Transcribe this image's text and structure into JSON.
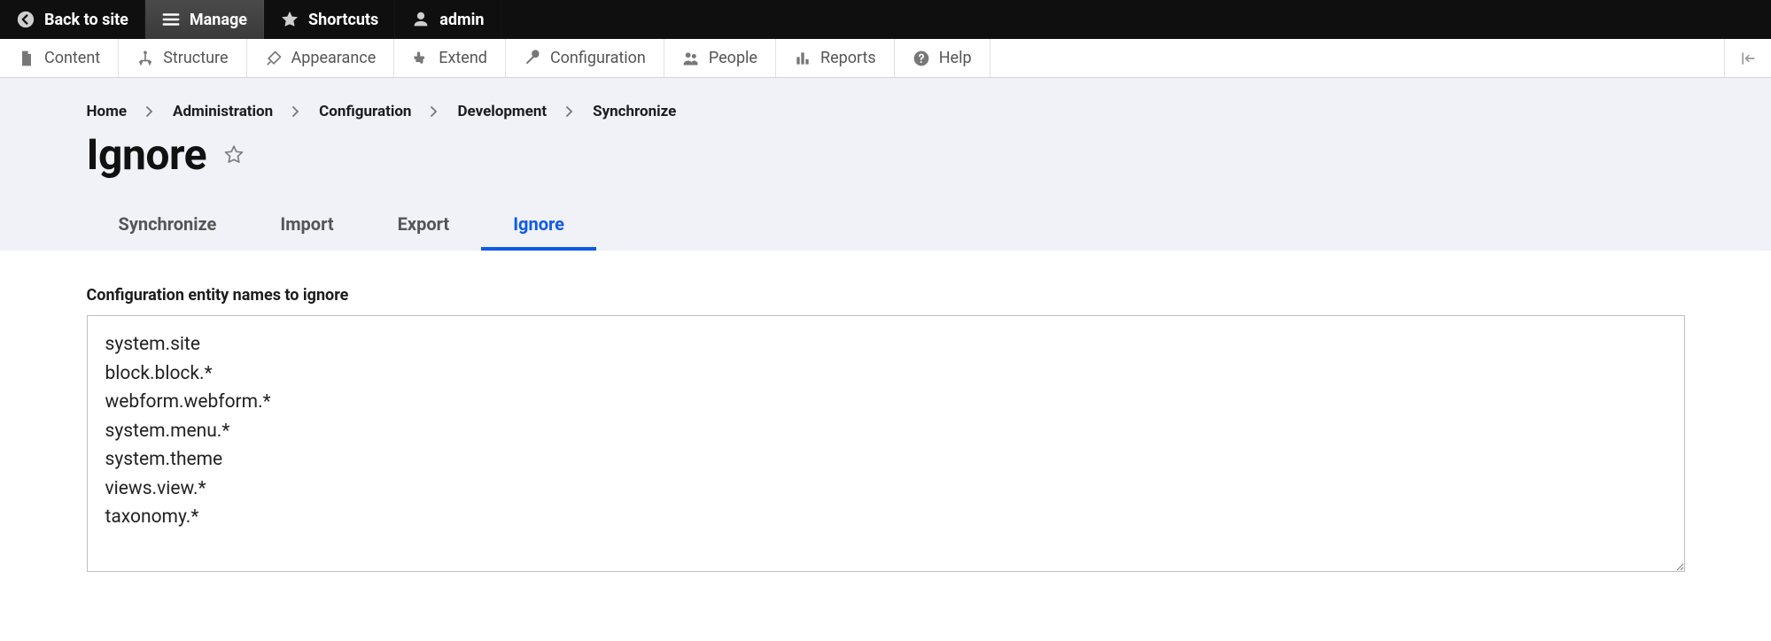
{
  "top_toolbar": {
    "back": "Back to site",
    "manage": "Manage",
    "shortcuts": "Shortcuts",
    "user": "admin"
  },
  "admin_menu": {
    "content": "Content",
    "structure": "Structure",
    "appearance": "Appearance",
    "extend": "Extend",
    "configuration": "Configuration",
    "people": "People",
    "reports": "Reports",
    "help": "Help"
  },
  "breadcrumb": [
    "Home",
    "Administration",
    "Configuration",
    "Development",
    "Synchronize"
  ],
  "page_title": "Ignore",
  "tabs": {
    "synchronize": "Synchronize",
    "import": "Import",
    "export": "Export",
    "ignore": "Ignore"
  },
  "form": {
    "field_label": "Configuration entity names to ignore",
    "value": "system.site\nblock.block.*\nwebform.webform.*\nsystem.menu.*\nsystem.theme\nviews.view.*\ntaxonomy.*"
  }
}
